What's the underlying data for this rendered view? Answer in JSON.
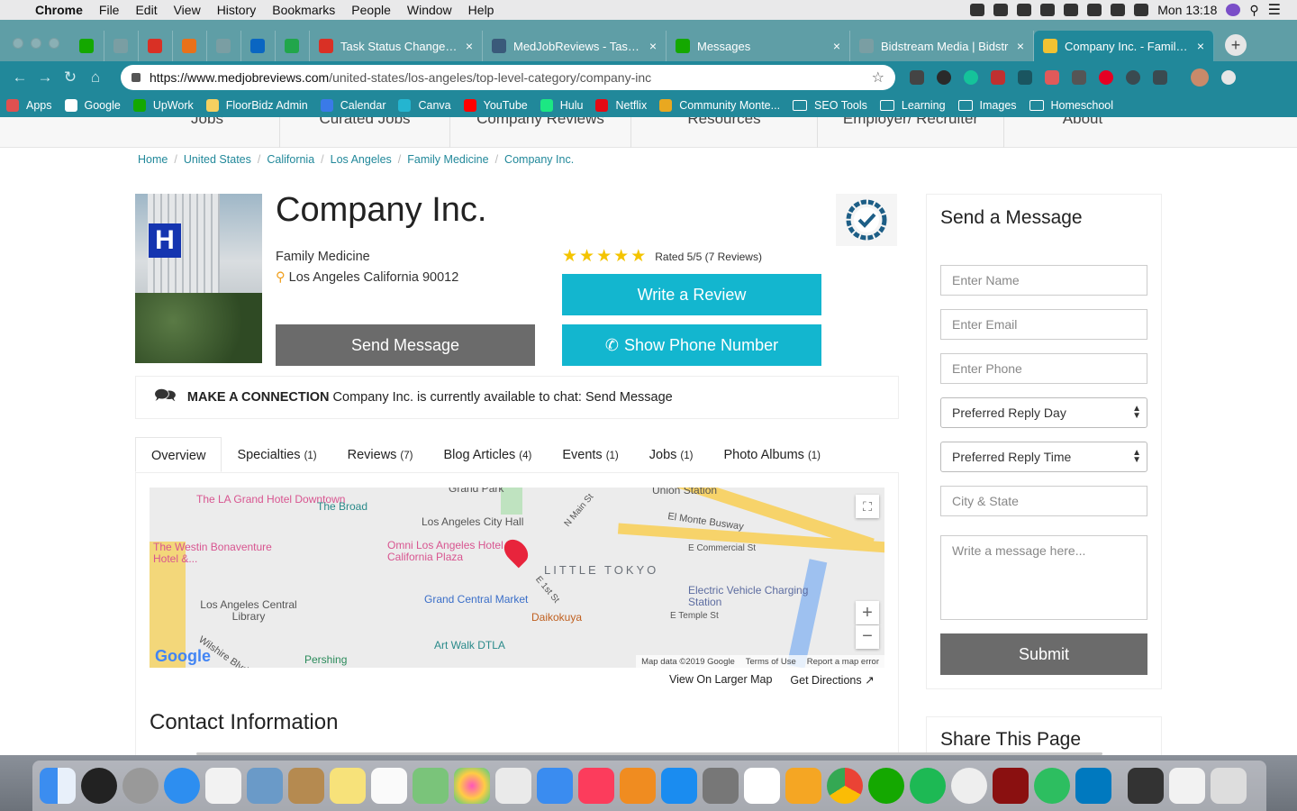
{
  "menubar": {
    "apple": "",
    "app": "Chrome",
    "items": [
      "File",
      "Edit",
      "View",
      "History",
      "Bookmarks",
      "People",
      "Window",
      "Help"
    ],
    "clock": "Mon 13:18"
  },
  "tabs": [
    {
      "icon": "upwork",
      "label": "",
      "color": "#14a800"
    },
    {
      "icon": "globe",
      "label": "",
      "color": "#7a9ea3"
    },
    {
      "icon": "gmail",
      "label": "",
      "color": "#d93025"
    },
    {
      "icon": "tp",
      "label": "",
      "color": "#e8711a"
    },
    {
      "icon": "globe",
      "label": "",
      "color": "#7a9ea3"
    },
    {
      "icon": "linkedin",
      "label": "",
      "color": "#0a66c2"
    },
    {
      "icon": "px",
      "label": "",
      "color": "#21a64b"
    },
    {
      "icon": "gmail",
      "label": "Task Status Changed - T",
      "color": "#d93025"
    },
    {
      "icon": "bl",
      "label": "MedJobReviews - Task C",
      "color": "#3a5a7a"
    },
    {
      "icon": "upwork",
      "label": "Messages",
      "color": "#14a800"
    },
    {
      "icon": "globe",
      "label": "Bidstream Media | Bidstr",
      "color": "#7a9ea3"
    },
    {
      "icon": "bulb",
      "label": "Company Inc. - Family M",
      "color": "#f1c232",
      "active": true
    }
  ],
  "url": {
    "host": "https://www.medjobreviews.com",
    "path": "/united-states/los-angeles/top-level-category/company-inc"
  },
  "bookmarks": [
    {
      "label": "Apps",
      "type": "apps"
    },
    {
      "label": "Google",
      "type": "google"
    },
    {
      "label": "UpWork",
      "type": "upwork"
    },
    {
      "label": "FloorBidz Admin",
      "type": "lock"
    },
    {
      "label": "Calendar",
      "type": "calendar"
    },
    {
      "label": "Canva",
      "type": "canva"
    },
    {
      "label": "YouTube",
      "type": "youtube"
    },
    {
      "label": "Hulu",
      "type": "hulu"
    },
    {
      "label": "Netflix",
      "type": "netflix"
    },
    {
      "label": "Community Monte...",
      "type": "slack"
    },
    {
      "label": "SEO Tools",
      "type": "folder"
    },
    {
      "label": "Learning",
      "type": "folder"
    },
    {
      "label": "Images",
      "type": "folder"
    },
    {
      "label": "Homeschool",
      "type": "folder"
    }
  ],
  "site_nav": [
    "Jobs",
    "Curated Jobs",
    "Company Reviews",
    "Resources",
    "Employer/ Recruiter",
    "About"
  ],
  "breadcrumb": [
    "Home",
    "United States",
    "California",
    "Los Angeles",
    "Family Medicine",
    "Company Inc."
  ],
  "company": {
    "name": "Company Inc.",
    "specialty": "Family Medicine",
    "address": "Los Angeles California 90012",
    "rating_text": "Rated 5/5 (7 Reviews)",
    "stars": 5
  },
  "buttons": {
    "review": "Write a Review",
    "phone": "Show Phone Number",
    "message": "Send Message"
  },
  "connection": {
    "label": "MAKE A CONNECTION",
    "text": "Company Inc. is currently available to chat:",
    "link": "Send Message"
  },
  "profile_tabs": [
    {
      "label": "Overview",
      "count": ""
    },
    {
      "label": "Specialties",
      "count": "(1)"
    },
    {
      "label": "Reviews",
      "count": "(7)"
    },
    {
      "label": "Blog Articles",
      "count": "(4)"
    },
    {
      "label": "Events",
      "count": "(1)"
    },
    {
      "label": "Jobs",
      "count": "(1)"
    },
    {
      "label": "Photo Albums",
      "count": "(1)"
    }
  ],
  "map": {
    "labels": [
      "The LA Grand Hotel Downtown",
      "The Broad",
      "Los Angeles City Hall",
      "The Westin Bonaventure Hotel &...",
      "Omni Los Angeles Hotel at California Plaza",
      "LITTLE TOKYO",
      "El Monte Busway",
      "E Commercial St",
      "Grand Central Market",
      "Los Angeles Central Library",
      "Daikokuya",
      "Electric Vehicle Charging Station",
      "E Temple St",
      "Art Walk DTLA",
      "Pershing",
      "Union Station",
      "Grand Park",
      "N Main St",
      "E 1st St",
      "Wilshire Blvd"
    ],
    "footer": [
      "Map data ©2019 Google",
      "Terms of Use",
      "Report a map error"
    ],
    "logo": "Google"
  },
  "map_links": {
    "larger": "View On Larger Map",
    "directions": "Get Directions"
  },
  "contact_title": "Contact Information",
  "form": {
    "title": "Send a Message",
    "name": "Enter Name",
    "email": "Enter Email",
    "phone": "Enter Phone",
    "day": "Preferred Reply Day",
    "time": "Preferred Reply Time",
    "city": "City & State",
    "message": "Write a message here...",
    "submit": "Submit"
  },
  "share_title": "Share This Page",
  "colors": {
    "accent": "#13b6cf",
    "chrome": "#21889a",
    "gray_button": "#6b6b6b",
    "star": "#f4c400"
  }
}
